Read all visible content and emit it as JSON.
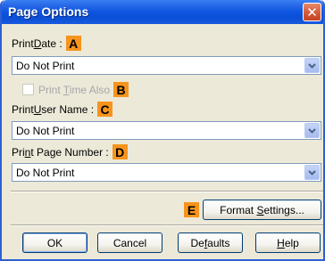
{
  "window": {
    "title": "Page Options",
    "close_glyph": "✕"
  },
  "print_date": {
    "label_pre": "Print ",
    "label_u": "D",
    "label_post": "ate :",
    "badge": "A",
    "value": "Do Not Print"
  },
  "print_time_also": {
    "label_pre": "Print ",
    "label_u": "T",
    "label_post": "ime Also",
    "badge": "B",
    "checked": false,
    "enabled": false
  },
  "print_user_name": {
    "label_pre": "Print ",
    "label_u": "U",
    "label_post": "ser Name :",
    "badge": "C",
    "value": "Do Not Print"
  },
  "print_page_number": {
    "label_pre": "Pri",
    "label_u": "n",
    "label_post": "t Page Number :",
    "badge": "D",
    "value": "Do Not Print"
  },
  "format_settings": {
    "badge": "E",
    "label_pre": "Format ",
    "label_u": "S",
    "label_post": "ettings..."
  },
  "buttons": {
    "ok": "OK",
    "cancel": "Cancel",
    "defaults_pre": "De",
    "defaults_u": "f",
    "defaults_post": "aults",
    "help_u": "H",
    "help_post": "elp"
  },
  "colors": {
    "accent_badge": "#f7941d",
    "titlebar": "#0a4fd6",
    "dialog_bg": "#ece9d8"
  }
}
